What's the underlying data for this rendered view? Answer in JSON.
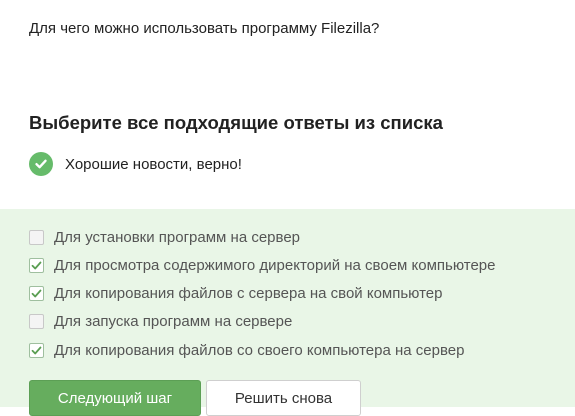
{
  "question": {
    "text": "Для чего можно использовать программу Filezilla?"
  },
  "instruction": {
    "text": "Выберите все подходящие ответы из списка"
  },
  "result": {
    "icon": "check-circle-icon",
    "text": "Хорошие новости, верно!",
    "color": "#66bb6a"
  },
  "options": [
    {
      "label": "Для установки программ на сервер",
      "checked": false
    },
    {
      "label": "Для просмотра содержимого директорий на своем компьютере",
      "checked": true
    },
    {
      "label": "Для копирования файлов с сервера на свой компьютер",
      "checked": true
    },
    {
      "label": "Для запуска программ на сервере",
      "checked": false
    },
    {
      "label": "Для копирования файлов со своего компьютера на сервер",
      "checked": true
    }
  ],
  "buttons": {
    "next_label": "Следующий шаг",
    "retry_label": "Решить снова"
  },
  "colors": {
    "accent": "#66ad5e",
    "answers_background": "#e9f6e7"
  }
}
